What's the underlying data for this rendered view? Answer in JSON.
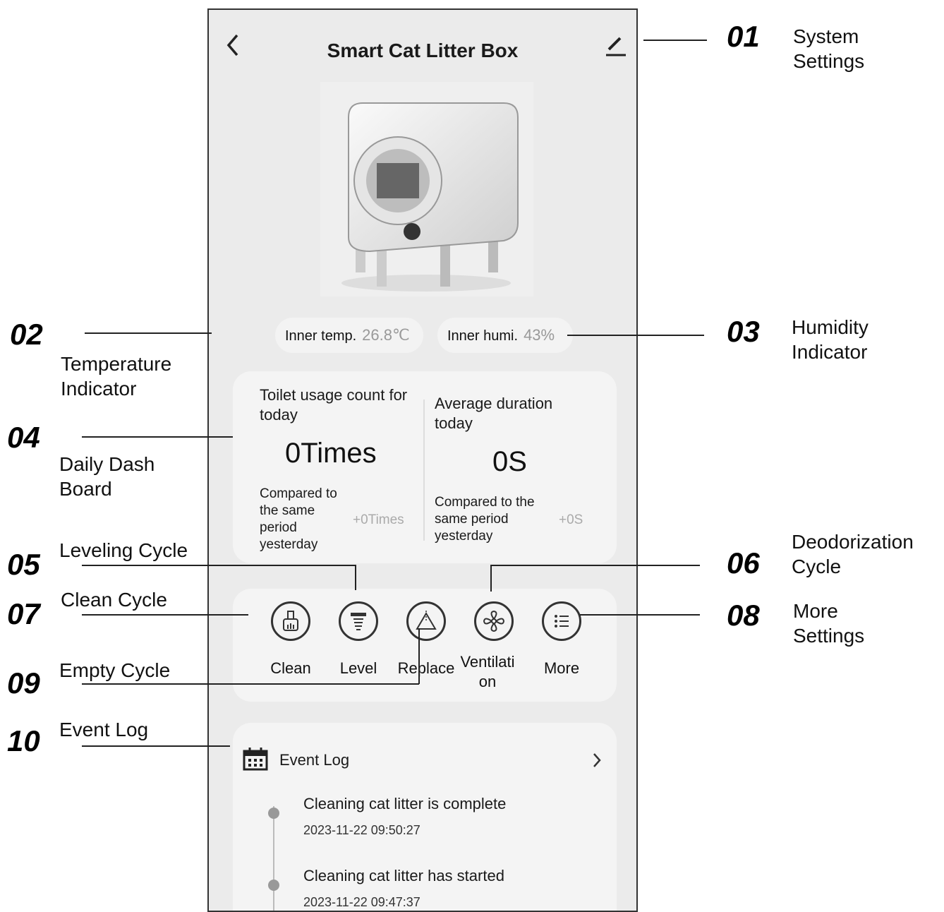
{
  "header": {
    "title": "Smart Cat Litter Box"
  },
  "indicators": {
    "temp_label": "Inner temp.",
    "temp_value": "26.8℃",
    "humi_label": "Inner humi.",
    "humi_value": "43%"
  },
  "dashboard": {
    "left": {
      "label": "Toilet usage count for today",
      "value": "0Times",
      "compare": "Compared to the same period yesterday",
      "delta": "+0Times"
    },
    "right": {
      "label": "Average duration today",
      "value": "0S",
      "compare": "Compared to the same period yesterday",
      "delta": "+0S"
    }
  },
  "actions": [
    {
      "label": "Clean",
      "icon": "broom-icon"
    },
    {
      "label": "Level",
      "icon": "level-icon"
    },
    {
      "label": "Replace",
      "icon": "replace-icon"
    },
    {
      "label": "Ventilation",
      "icon": "fan-icon"
    },
    {
      "label": "More",
      "icon": "list-icon"
    }
  ],
  "event_log": {
    "title": "Event Log",
    "events": [
      {
        "title": "Cleaning cat litter is complete",
        "time": "2023-11-22 09:50:27"
      },
      {
        "title": "Cleaning cat litter has started",
        "time": "2023-11-22 09:47:37"
      }
    ]
  },
  "annotations": [
    {
      "num": "01",
      "text": "System Settings"
    },
    {
      "num": "02",
      "text": "Temperature Indicator"
    },
    {
      "num": "03",
      "text": "Humidity Indicator"
    },
    {
      "num": "04",
      "text": "Daily Dash Board"
    },
    {
      "num": "05",
      "text": "Leveling Cycle"
    },
    {
      "num": "06",
      "text": "Deodorization Cycle"
    },
    {
      "num": "07",
      "text": "Clean Cycle"
    },
    {
      "num": "08",
      "text": "More Settings"
    },
    {
      "num": "09",
      "text": "Empty Cycle"
    },
    {
      "num": "10",
      "text": "Event Log"
    }
  ]
}
